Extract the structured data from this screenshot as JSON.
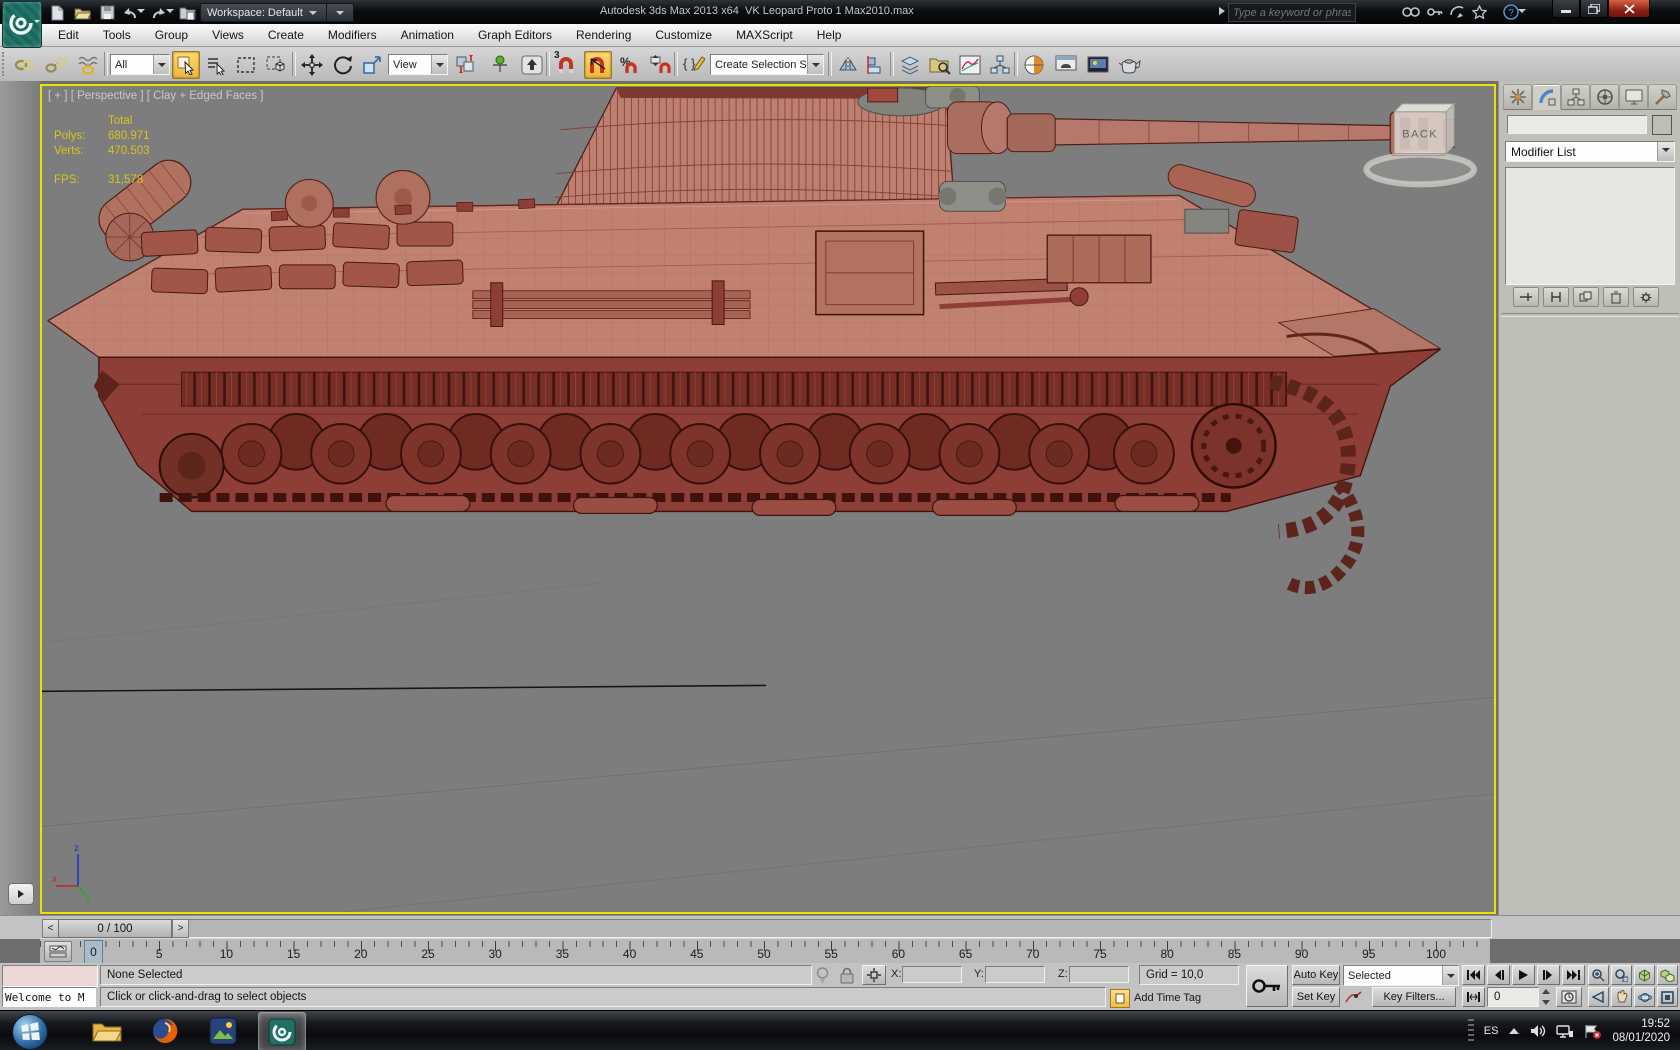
{
  "titlebar": {
    "app_title": "Autodesk 3ds Max 2013 x64",
    "doc_title": "VK Leopard Proto 1 Max2010.max",
    "workspace_label": "Workspace: Default",
    "search_placeholder": "Type a keyword or phrase"
  },
  "menubar": {
    "items": [
      "Edit",
      "Tools",
      "Group",
      "Views",
      "Create",
      "Modifiers",
      "Animation",
      "Graph Editors",
      "Rendering",
      "Customize",
      "MAXScript",
      "Help"
    ]
  },
  "toolbar": {
    "selection_filter": "All",
    "snap_label": "3",
    "ref_coord": "View",
    "selection_set_placeholder": "Create Selection Se"
  },
  "viewport": {
    "header": "[ + ] [ Perspective ] [ Clay + Edged Faces ]",
    "stats": {
      "total_label": "Total",
      "polys_label": "Polys:",
      "polys_value": "680.971",
      "verts_label": "Verts:",
      "verts_value": "470.503",
      "fps_label": "FPS:",
      "fps_value": "31,578"
    },
    "viewcube_face": "BACK",
    "axis": {
      "x": "x",
      "y": "y",
      "z": "z"
    }
  },
  "command_panel": {
    "modifier_list_label": "Modifier List",
    "object_color": "#d23a8e"
  },
  "timeline": {
    "slider_value": "0 / 100",
    "prev_label": "<",
    "next_label": ">",
    "current_frame": "0",
    "tick_labels": [
      "0",
      "5",
      "10",
      "15",
      "20",
      "25",
      "30",
      "35",
      "40",
      "45",
      "50",
      "55",
      "60",
      "65",
      "70",
      "75",
      "80",
      "85",
      "90",
      "95",
      "100"
    ]
  },
  "statusbar": {
    "listener_text": "Welcome to M",
    "selection_status": "None Selected",
    "prompt": "Click or click-and-drag to select objects",
    "coord_x_label": "X:",
    "coord_y_label": "Y:",
    "coord_z_label": "Z:",
    "grid_label": "Grid = 10,0",
    "add_time_tag": "Add Time Tag",
    "auto_key_label": "Auto Key",
    "set_key_label": "Set Key",
    "key_mode_selected": "Selected",
    "key_filters_label": "Key Filters...",
    "frame_value": "0"
  },
  "taskbar": {
    "language": "ES",
    "clock_time": "19:52",
    "clock_date": "08/01/2020"
  }
}
